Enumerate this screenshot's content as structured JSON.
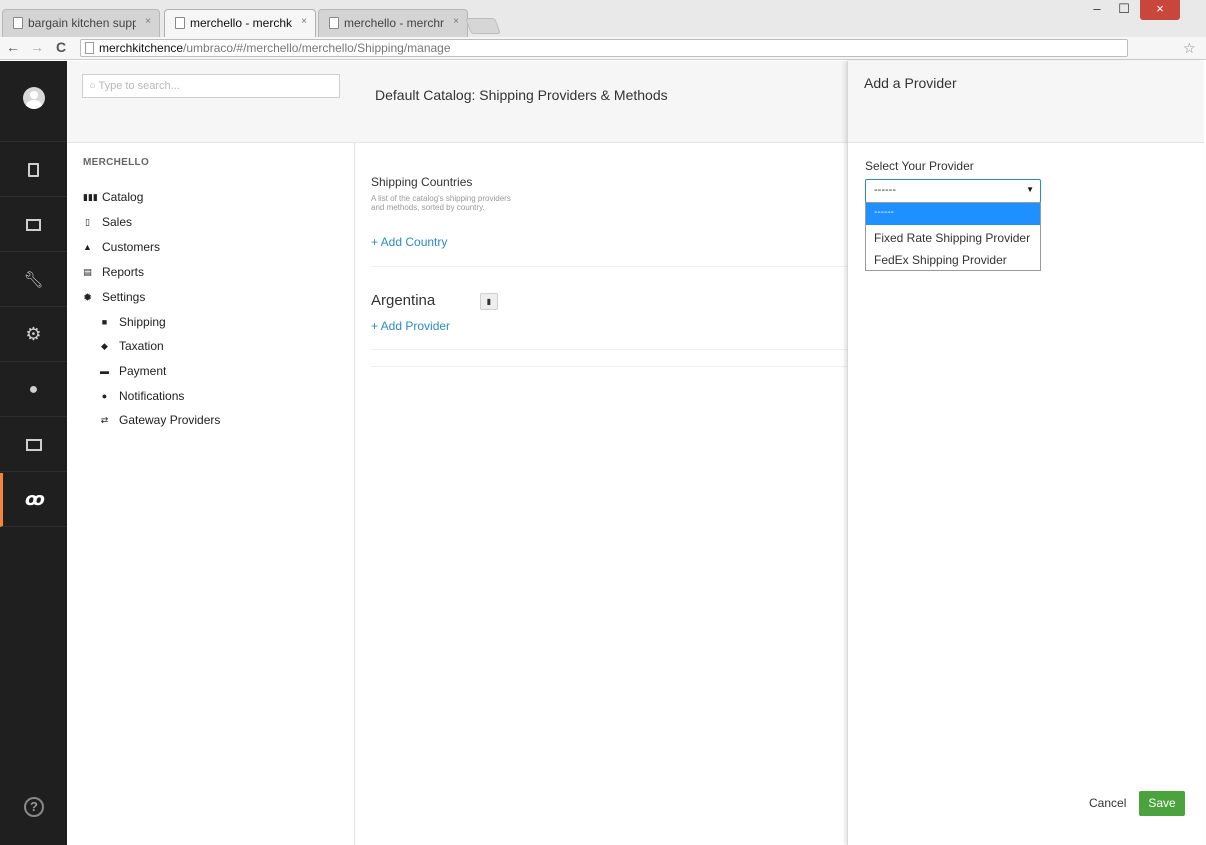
{
  "browser": {
    "tabs": [
      {
        "title": "bargain kitchen supp"
      },
      {
        "title": "merchello - merchkit"
      },
      {
        "title": "merchello - merchro"
      }
    ],
    "tab_close": "×",
    "url_host": "merchkitchence",
    "url_path": "/umbraco/#/merchello/merchello/Shipping/manage",
    "window_controls": {
      "min": "–",
      "max": "☐",
      "close": "×"
    },
    "extensions": {
      "first": "Ø"
    }
  },
  "rail": {
    "icons": [
      "avatar",
      "document-icon",
      "media-icon",
      "wrench-icon",
      "gear-icon",
      "user-icon",
      "contact-card-icon",
      "merchello-icon"
    ],
    "help": "?",
    "accent_color": "#f0853b"
  },
  "tree": {
    "search_placeholder": "Type to search...",
    "section_title": "MERCHELLO",
    "items": [
      {
        "label": "Catalog",
        "icon": "barcode-icon"
      },
      {
        "label": "Sales",
        "icon": "receipt-icon"
      },
      {
        "label": "Customers",
        "icon": "user-icon"
      },
      {
        "label": "Reports",
        "icon": "report-icon"
      },
      {
        "label": "Settings",
        "icon": "gear-icon"
      }
    ],
    "settings_children": [
      {
        "label": "Shipping",
        "icon": "truck-icon"
      },
      {
        "label": "Taxation",
        "icon": "tax-icon"
      },
      {
        "label": "Payment",
        "icon": "payment-icon"
      },
      {
        "label": "Notifications",
        "icon": "chat-icon"
      },
      {
        "label": "Gateway Providers",
        "icon": "gateway-icon"
      }
    ]
  },
  "main": {
    "title": "Default Catalog: Shipping Providers & Methods",
    "shipping_countries_heading": "Shipping Countries",
    "shipping_countries_desc": "A list of the catalog's shipping providers and methods, sorted by country.",
    "add_country": "+ Add Country",
    "countries": [
      {
        "name": "Argentina",
        "add_provider": "+ Add Provider"
      }
    ]
  },
  "dialog": {
    "title": "Add a Provider",
    "select_label": "Select Your Provider",
    "select_value": "------",
    "options": [
      "------",
      "Fixed Rate Shipping Provider",
      "FedEx Shipping Provider"
    ],
    "cancel_label": "Cancel",
    "save_label": "Save",
    "save_color": "#4aa33c",
    "selected_option_color": "#1e90ff"
  }
}
